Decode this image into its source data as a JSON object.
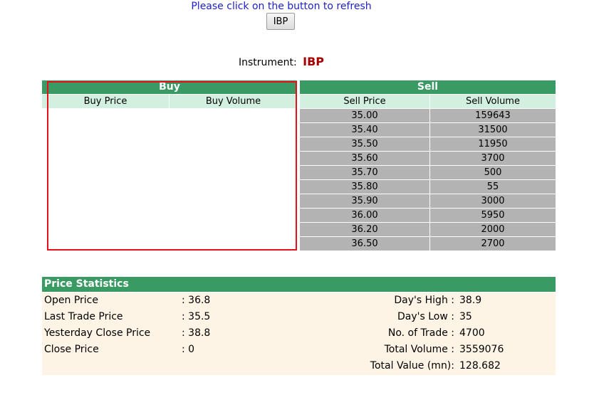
{
  "header": {
    "refresh_message": "Please click on the button to refresh",
    "refresh_button": "IBP",
    "instrument_label": "Instrument:",
    "instrument_symbol": "IBP"
  },
  "buy": {
    "title": "Buy",
    "columns": [
      "Buy Price",
      "Buy Volume"
    ],
    "rows": []
  },
  "sell": {
    "title": "Sell",
    "columns": [
      "Sell Price",
      "Sell Volume"
    ],
    "rows": [
      {
        "price": "35.00",
        "volume": "159643"
      },
      {
        "price": "35.40",
        "volume": "31500"
      },
      {
        "price": "35.50",
        "volume": "11950"
      },
      {
        "price": "35.60",
        "volume": "3700"
      },
      {
        "price": "35.70",
        "volume": "500"
      },
      {
        "price": "35.80",
        "volume": "55"
      },
      {
        "price": "35.90",
        "volume": "3000"
      },
      {
        "price": "36.00",
        "volume": "5950"
      },
      {
        "price": "36.20",
        "volume": "2000"
      },
      {
        "price": "36.50",
        "volume": "2700"
      }
    ]
  },
  "stats": {
    "title": "Price Statistics",
    "left": [
      {
        "label": "Open Price",
        "value": ": 36.8"
      },
      {
        "label": "Last Trade Price",
        "value": ": 35.5"
      },
      {
        "label": "Yesterday Close Price",
        "value": ": 38.8"
      },
      {
        "label": "Close Price",
        "value": ": 0"
      }
    ],
    "right": [
      {
        "label": "Day's High :",
        "value": "38.9"
      },
      {
        "label": "Day's Low :",
        "value": "35"
      },
      {
        "label": "No. of Trade :",
        "value": "4700"
      },
      {
        "label": "Total Volume :",
        "value": "3559076"
      },
      {
        "label": "Total Value (mn):",
        "value": "128.682"
      }
    ]
  },
  "colors": {
    "header_green": "#3a9a63",
    "column_header": "#d2f0e0",
    "sell_cell": "#b3b3b3",
    "stats_background": "#fdf4e6",
    "highlight_border": "#e6121b",
    "symbol_red": "#a40000",
    "link_blue": "#1f20cc"
  }
}
